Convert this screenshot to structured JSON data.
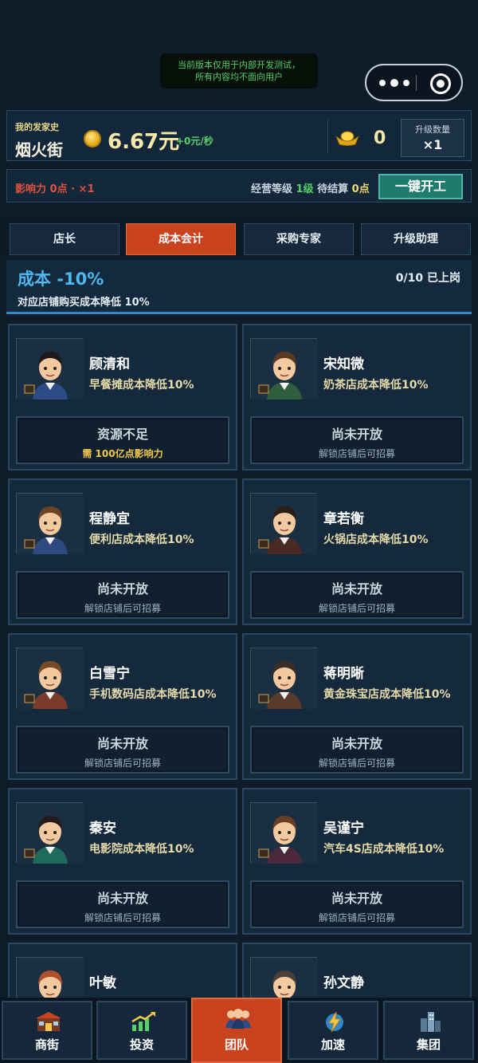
{
  "notice": {
    "line1": "当前版本仅用于内部开发测试，",
    "line2": "所有内容均不面向用户"
  },
  "status": {
    "history_label": "我的发家史",
    "street_name": "烟火街",
    "money": "6.67元",
    "rate": "+0元/秒",
    "ingot_count": "0",
    "upgrade_qty_label": "升级数量",
    "upgrade_qty_value": "×1"
  },
  "business": {
    "influence": "影响力 0点 · ×1",
    "level_label": "经营等级",
    "level_value": "1级",
    "pending_label": "待结算",
    "pending_value": "0点",
    "one_key_button": "一键开工"
  },
  "tabs": [
    {
      "label": "店长"
    },
    {
      "label": "成本会计"
    },
    {
      "label": "采购专家"
    },
    {
      "label": "升级助理"
    }
  ],
  "active_tab": "成本会计",
  "header": {
    "title": "成本 -10%",
    "posted": "0/10 已上岗",
    "desc": "对应店铺购买成本降低 10%"
  },
  "staff": [
    {
      "name": "顾清和",
      "desc": "早餐摊成本降低10%",
      "status": "资源不足",
      "sub": "需 100亿点影响力",
      "hair": "#1e1a1c",
      "shirt": "#2d4b86"
    },
    {
      "name": "宋知微",
      "desc": "奶茶店成本降低10%",
      "status": "尚未开放",
      "sub": "解锁店铺后可招募",
      "hair": "#5a3a22",
      "shirt": "#2f5d40"
    },
    {
      "name": "程静宜",
      "desc": "便利店成本降低10%",
      "status": "尚未开放",
      "sub": "解锁店铺后可招募",
      "hair": "#6b4426",
      "shirt": "#2e4a7e"
    },
    {
      "name": "章若衡",
      "desc": "火锅店成本降低10%",
      "status": "尚未开放",
      "sub": "解锁店铺后可招募",
      "hair": "#2a1e16",
      "shirt": "#4a2a22"
    },
    {
      "name": "白雪宁",
      "desc": "手机数码店成本降低10%",
      "status": "尚未开放",
      "sub": "解锁店铺后可招募",
      "hair": "#7a4a26",
      "shirt": "#7b3b2a"
    },
    {
      "name": "蒋明晰",
      "desc": "黄金珠宝店成本降低10%",
      "status": "尚未开放",
      "sub": "解锁店铺后可招募",
      "hair": "#3a2e26",
      "shirt": "#5a3a2a"
    },
    {
      "name": "秦安",
      "desc": "电影院成本降低10%",
      "status": "尚未开放",
      "sub": "解锁店铺后可招募",
      "hair": "#241c1a",
      "shirt": "#1f6a5a"
    },
    {
      "name": "吴谨宁",
      "desc": "汽车4S店成本降低10%",
      "status": "尚未开放",
      "sub": "解锁店铺后可招募",
      "hair": "#6a3e22",
      "shirt": "#4a2a3a"
    },
    {
      "name": "叶敏",
      "desc": "",
      "status": "",
      "sub": "",
      "hair": "#b0502a",
      "shirt": "#7a3a2a"
    },
    {
      "name": "孙文静",
      "desc": "",
      "status": "",
      "sub": "",
      "hair": "#4a4038",
      "shirt": "#3a4a5a"
    }
  ],
  "nav": [
    {
      "label": "商街",
      "icon": "storefront-icon"
    },
    {
      "label": "投资",
      "icon": "chart-up-icon"
    },
    {
      "label": "团队",
      "icon": "team-icon"
    },
    {
      "label": "加速",
      "icon": "speed-lightning-icon"
    },
    {
      "label": "集团",
      "icon": "buildings-icon"
    }
  ],
  "active_nav": "团队",
  "colors": {
    "accent_active": "#c9431f",
    "positive": "#57d06a",
    "cost_title": "#4fb6ef",
    "warning": "#e0523d",
    "gold": "#f1c84a"
  }
}
